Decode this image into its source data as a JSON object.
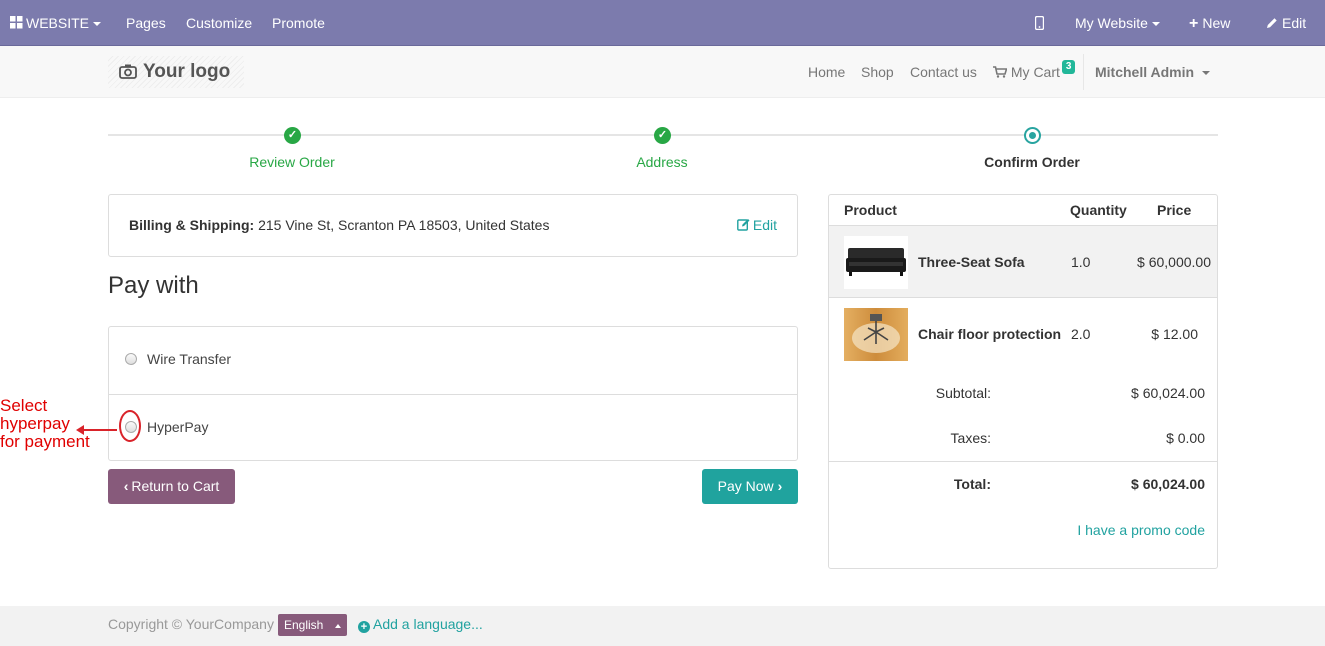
{
  "admin_bar": {
    "website_menu": "WEBSITE",
    "pages": "Pages",
    "customize": "Customize",
    "promote": "Promote",
    "my_website": "My Website",
    "new_label": "New",
    "edit_label": "Edit",
    "background_color": "#7c7bad"
  },
  "header": {
    "logo_text": "Your logo",
    "nav": [
      "Home",
      "Shop",
      "Contact us"
    ],
    "cart_label": "My Cart",
    "cart_count": "3",
    "user": "Mitchell Admin"
  },
  "wizard": {
    "steps": [
      {
        "label": "Review Order",
        "state": "done"
      },
      {
        "label": "Address",
        "state": "done"
      },
      {
        "label": "Confirm Order",
        "state": "current"
      }
    ]
  },
  "billing": {
    "label": "Billing & Shipping:",
    "address": " 215 Vine St, Scranton PA 18503, United States",
    "edit_label": "Edit"
  },
  "payment": {
    "title": "Pay with",
    "options": [
      "Wire Transfer",
      "HyperPay"
    ]
  },
  "annotation": {
    "line1": "Select",
    "line2": "hyperpay",
    "line3": "for payment",
    "color": "#e00000"
  },
  "buttons": {
    "return_to_cart": "Return to Cart",
    "pay_now": "Pay Now"
  },
  "cart_summary": {
    "headers": {
      "product": "Product",
      "quantity": "Quantity",
      "price": "Price"
    },
    "items": [
      {
        "name": "Three-Seat Sofa",
        "quantity": "1.0",
        "price": "$ 60,000.00"
      },
      {
        "name": "Chair floor protection",
        "quantity": "2.0",
        "price": "$ 12.00"
      }
    ],
    "subtotal_label": "Subtotal:",
    "subtotal": "$ 60,024.00",
    "taxes_label": "Taxes:",
    "taxes": "$ 0.00",
    "total_label": "Total:",
    "total": "$ 60,024.00",
    "promo_label": "I have a promo code"
  },
  "footer": {
    "copyright": "Copyright © YourCompany",
    "language": "English",
    "add_language": "Add a language..."
  },
  "colors": {
    "primary": "#875a7b",
    "accent": "#20a39e",
    "success": "#28a745"
  }
}
